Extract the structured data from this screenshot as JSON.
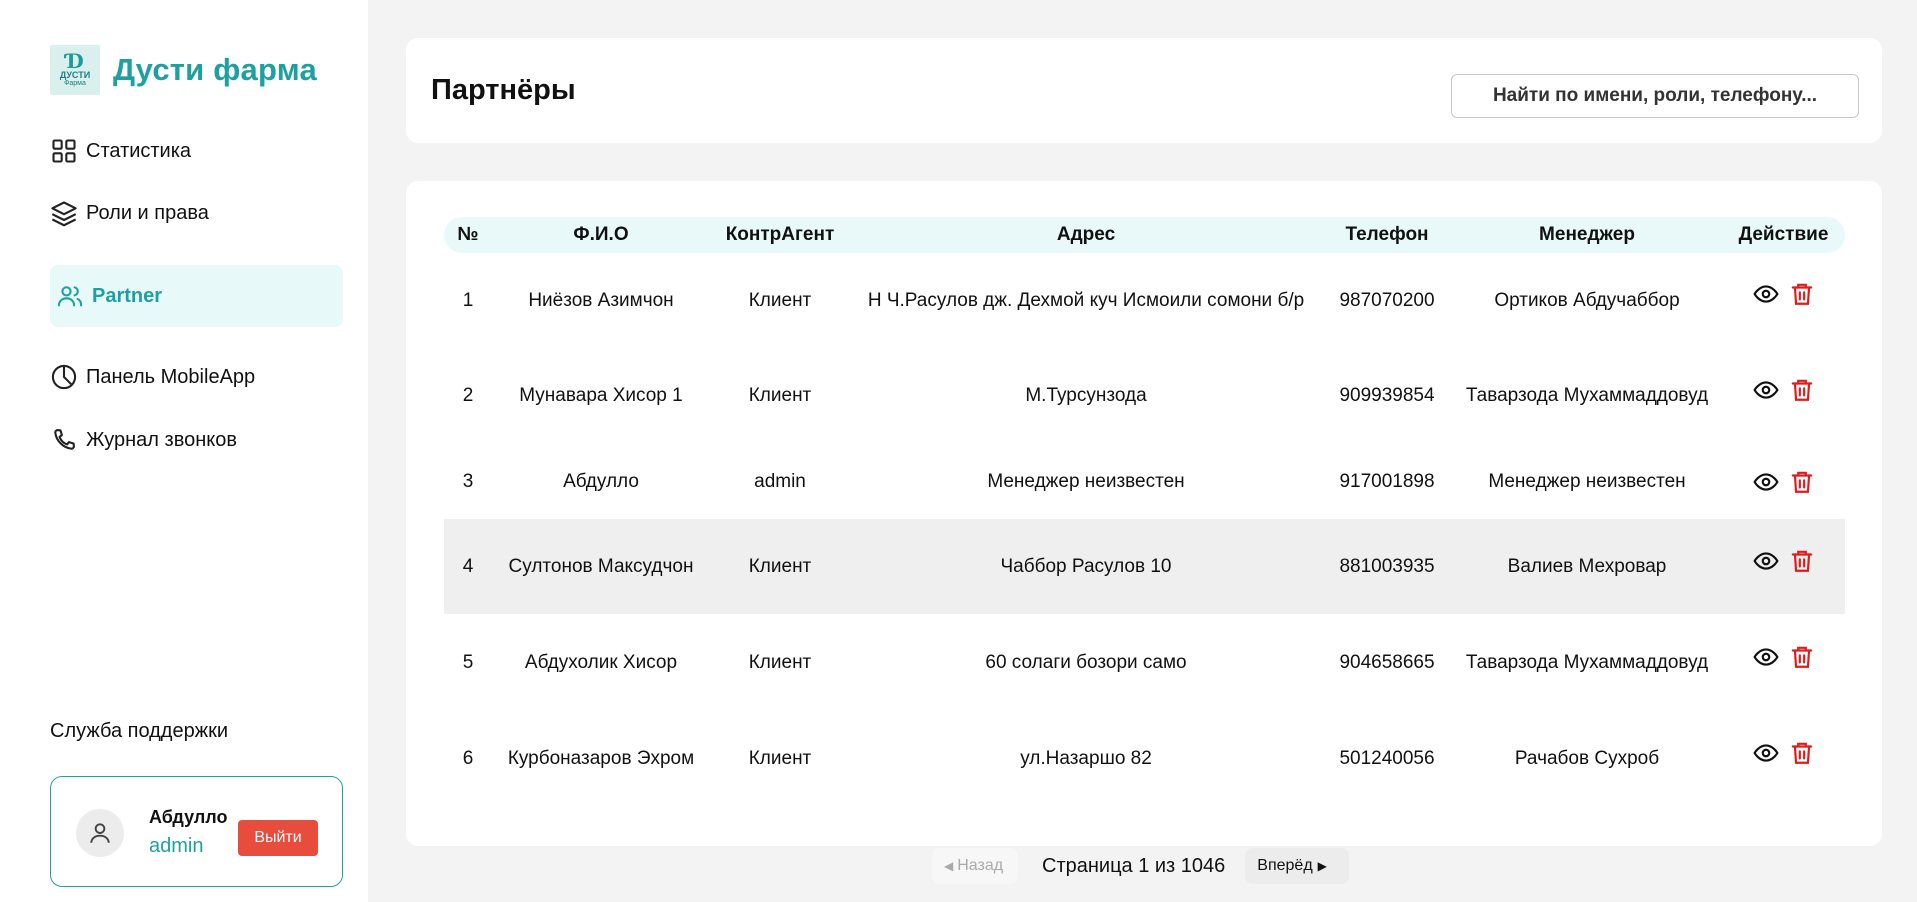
{
  "brand": {
    "name": "Дусти фарма",
    "logo_text": "ДУСТИ",
    "logo_sub": "Фарма"
  },
  "nav": [
    {
      "label": "Статистика",
      "icon": "grid-icon"
    },
    {
      "label": "Роли и права",
      "icon": "layers-icon"
    },
    {
      "label": "Partner",
      "icon": "users-icon",
      "active": true
    },
    {
      "label": "Панель MobileApp",
      "icon": "pie-chart-icon"
    },
    {
      "label": "Журнал звонков",
      "icon": "phone-icon"
    }
  ],
  "support": {
    "label": "Служба поддержки"
  },
  "user": {
    "name": "Абдулло",
    "role": "admin",
    "logout_label": "Выйти"
  },
  "header": {
    "title": "Партнёры",
    "search_placeholder": "Найти по имени, роли, телефону..."
  },
  "table": {
    "columns": [
      "№",
      "Ф.И.О",
      "КонтрАгент",
      "Адрес",
      "Телефон",
      "Менеджер",
      "Действие"
    ],
    "rows": [
      {
        "num": "1",
        "name": "Ниёзов Азимчон",
        "type": "Клиент",
        "address": "Н Ч.Расулов дж. Дехмой куч Исмоили сомони б/р",
        "phone": "987070200",
        "manager": "Ортиков Абдучаббор"
      },
      {
        "num": "2",
        "name": "Мунавара Хисор 1",
        "type": "Клиент",
        "address": "М.Турсунзода",
        "phone": "909939854",
        "manager": "Таварзода Мухаммаддовуд"
      },
      {
        "num": "3",
        "name": "Абдулло",
        "type": "admin",
        "address": "Менеджер неизвестен",
        "phone": "917001898",
        "manager": "Менеджер неизвестен"
      },
      {
        "num": "4",
        "name": "Султонов Максудчон",
        "type": "Клиент",
        "address": "Чаббор Расулов 10",
        "phone": "881003935",
        "manager": "Валиев Мехровар"
      },
      {
        "num": "5",
        "name": "Абдухолик Хисор",
        "type": "Клиент",
        "address": "60 солаги бозори само",
        "phone": "904658665",
        "manager": "Таварзода Мухаммаддовуд"
      },
      {
        "num": "6",
        "name": "Курбоназаров Эхром",
        "type": "Клиент",
        "address": "ул.Назаршо 82",
        "phone": "501240056",
        "manager": "Рачабов Сухроб"
      }
    ]
  },
  "pagination": {
    "prev_label": "Назад",
    "info": "Страница 1 из 1046",
    "next_label": "Вперёд"
  },
  "colors": {
    "accent": "#1fa0a0",
    "danger": "#e74c3c",
    "active_bg": "#e7f9f9",
    "header_bg": "#e9f9f9"
  }
}
